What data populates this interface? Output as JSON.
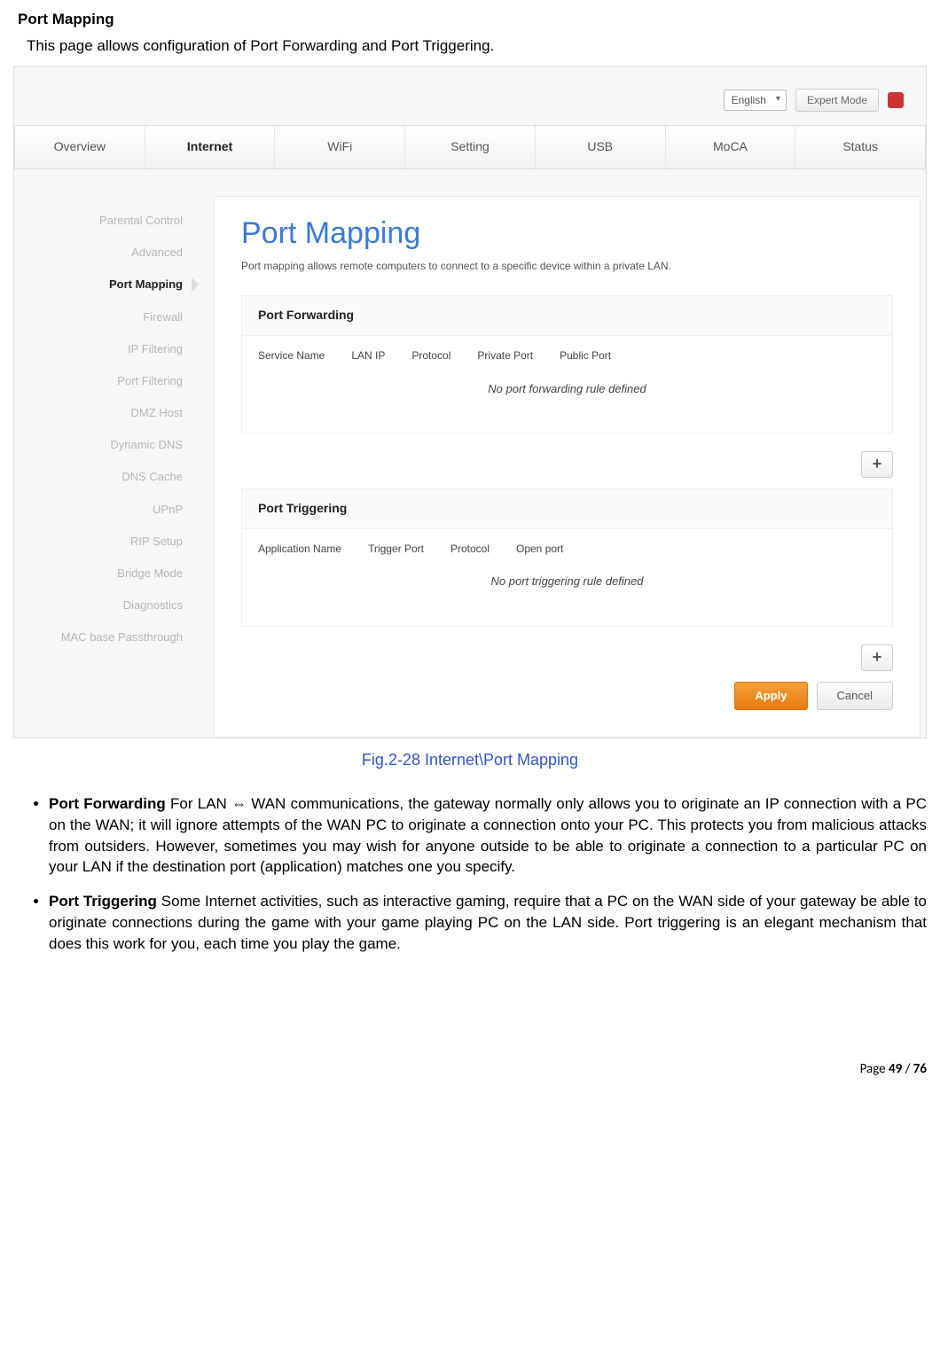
{
  "doc": {
    "heading": "Port Mapping",
    "subheading": "This page allows configuration of Port Forwarding and Port Triggering."
  },
  "topbar": {
    "language": "English",
    "mode_button": "Expert Mode"
  },
  "tabs": [
    "Overview",
    "Internet",
    "WiFi",
    "Setting",
    "USB",
    "MoCA",
    "Status"
  ],
  "active_tab": "Internet",
  "sidebar": {
    "items": [
      "Parental Control",
      "Advanced",
      "Port Mapping",
      "Firewall",
      "IP Filtering",
      "Port Filtering",
      "DMZ Host",
      "Dynamic DNS",
      "DNS Cache",
      "UPnP",
      "RIP Setup",
      "Bridge Mode",
      "Diagnostics",
      "MAC base Passthrough"
    ],
    "selected": "Port Mapping"
  },
  "content": {
    "title": "Port Mapping",
    "description": "Port mapping allows remote computers to connect to a specific device within a private LAN.",
    "port_forwarding": {
      "header": "Port Forwarding",
      "columns": [
        "Service Name",
        "LAN IP",
        "Protocol",
        "Private Port",
        "Public Port"
      ],
      "empty": "No port forwarding rule defined"
    },
    "port_triggering": {
      "header": "Port Triggering",
      "columns": [
        "Application Name",
        "Trigger Port",
        "Protocol",
        "Open port"
      ],
      "empty": "No port triggering rule defined"
    },
    "apply": "Apply",
    "cancel": "Cancel",
    "plus": "+"
  },
  "caption": "Fig.2-28 Internet\\Port Mapping",
  "bullets": {
    "pf_lead": "Port Forwarding",
    "pf_text": " For LAN ⇔ WAN communications, the gateway normally only allows you to originate an IP connection with a PC on the WAN; it will ignore attempts of the WAN PC to originate a connection onto your PC. This protects you from malicious attacks from outsiders. However, sometimes you may wish for anyone outside to be able to originate a connection to a particular PC on your LAN if the destination port (application) matches one you specify.",
    "pt_lead": "Port Triggering",
    "pt_text": " Some Internet activities, such as interactive gaming, require that a PC on the WAN side of your gateway be able to originate connections during the game with your game playing PC on the LAN side. Port triggering is an elegant mechanism that does this work for you, each time you play the game."
  },
  "footer": {
    "prefix": "Page ",
    "current": "49",
    "sep": " / ",
    "total": "76"
  }
}
